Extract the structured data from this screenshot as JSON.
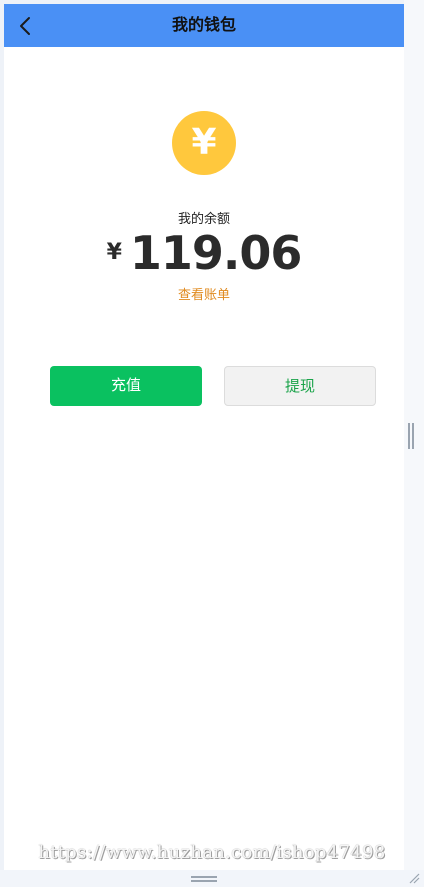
{
  "nav": {
    "title": "我的钱包",
    "back_icon": "chevron-left-icon"
  },
  "wallet": {
    "coin_icon": "yen-coin-icon",
    "coin_symbol": "¥",
    "balance_label": "我的余额",
    "currency_symbol": "¥",
    "balance_amount": "119.06",
    "bill_link": "查看账单"
  },
  "actions": {
    "recharge_label": "充值",
    "withdraw_label": "提现"
  },
  "watermark": {
    "text": "https://www.huzhan.com/ishop47498"
  },
  "colors": {
    "nav_background": "#4a90f5",
    "coin": "#ffc83d",
    "bill_link": "#e08a1e",
    "recharge_button": "#0ac160",
    "withdraw_text": "#1aa34a"
  }
}
